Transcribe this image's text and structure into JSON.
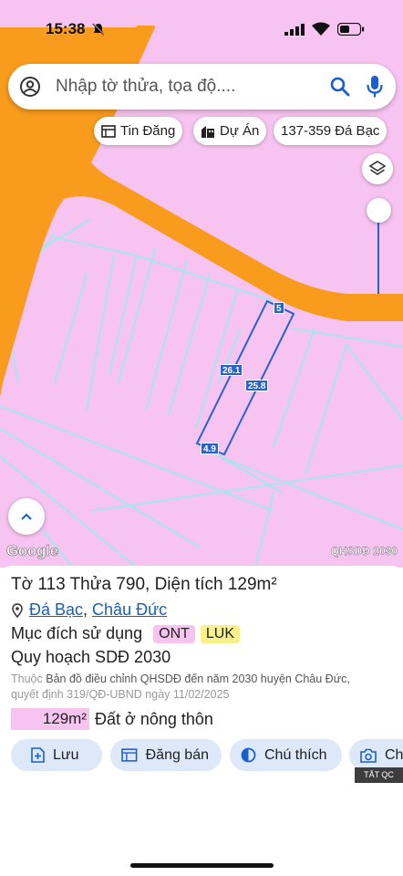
{
  "status_bar": {
    "time": "15:38"
  },
  "search": {
    "placeholder": "Nhập tờ thửa, tọa độ...."
  },
  "chips": {
    "news": "Tin Đăng",
    "projects": "Dự Án",
    "address": "137-359 Đá Bạc"
  },
  "map": {
    "google_label": "Google",
    "layer_label": "QHSDĐ 2030",
    "parcel_labels": [
      "5",
      "26.1",
      "25.8",
      "4.9"
    ]
  },
  "sheet": {
    "title": "Tờ 113 Thửa 790, Diện tích 129m²",
    "location": {
      "commune": "Đá Bạc",
      "separator": ",",
      "district": "Châu Đức"
    },
    "purpose_label": "Mục đích sử dụng",
    "tags": [
      {
        "code": "ONT",
        "color": "#f7c3f0"
      },
      {
        "code": "LUK",
        "color": "#f9f08a"
      }
    ],
    "plan": "Quy hoạch SDĐ 2030",
    "note_prefix": "Thuộc",
    "note_body": "Bản đồ điều chỉnh QHSDĐ đến năm 2030 huyện Châu Đức,",
    "note_line2": "quyết định 319/QĐ-UBND ngày 11/02/2025",
    "area_value": "129m²",
    "area_type": "Đất ở nông thôn"
  },
  "actions": {
    "save": "Lưu",
    "post_sale": "Đăng bán",
    "annotate": "Chú thích",
    "capture": "Ch"
  },
  "tat_qc": "TẮT QC",
  "colors": {
    "land_pink": "#f7c3f0",
    "road_orange": "#f99b1c",
    "accent_blue": "#2a63c7",
    "tag_yellow": "#f9f08a"
  }
}
